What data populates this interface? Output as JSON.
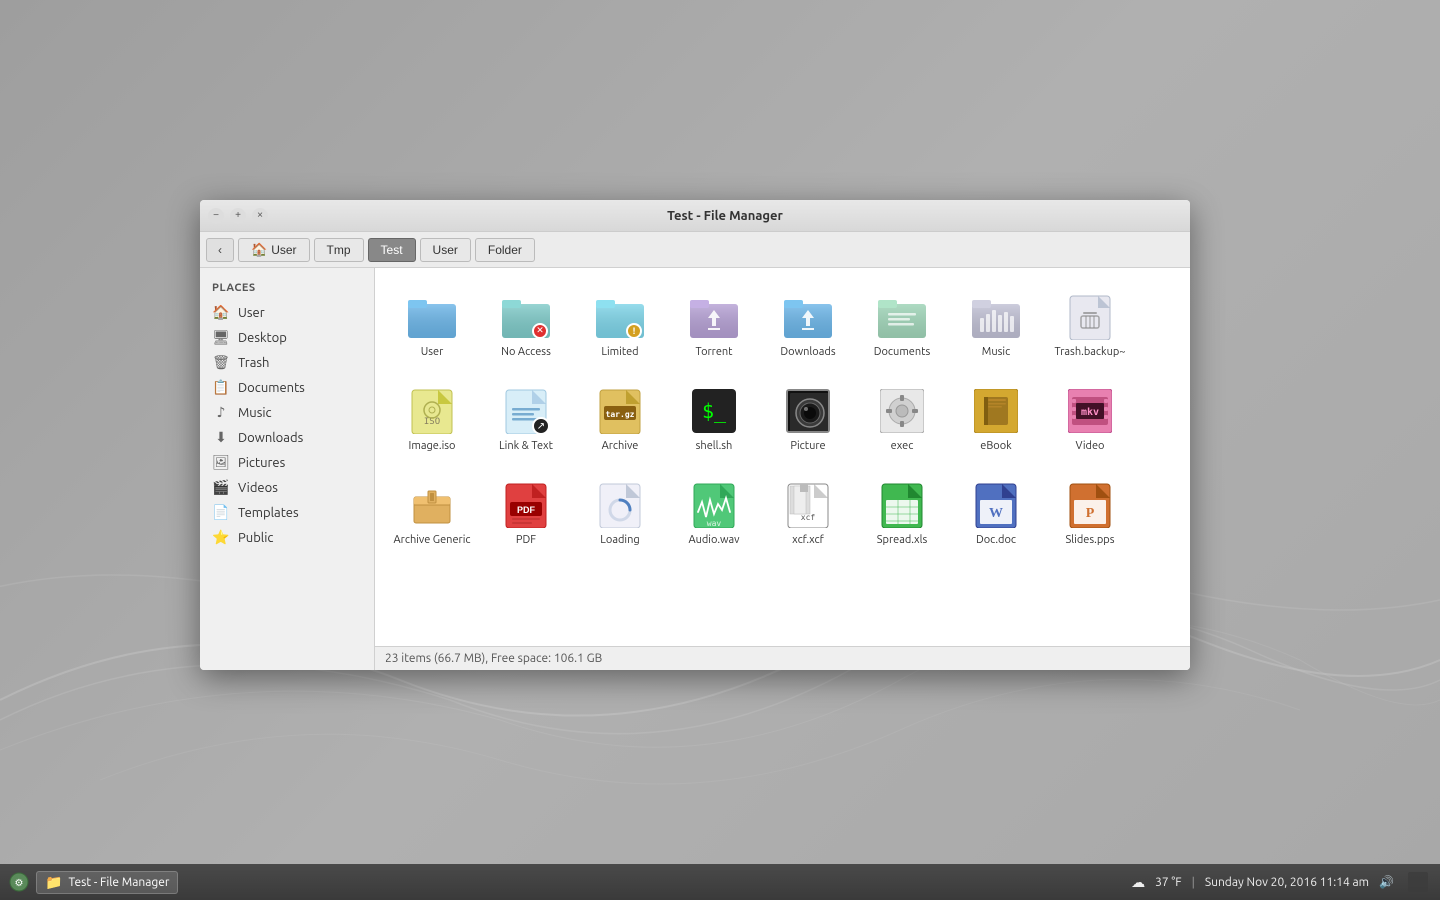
{
  "window": {
    "title": "Test - File Manager"
  },
  "titlebar": {
    "title": "Test - File Manager",
    "minimize_label": "−",
    "maximize_label": "+",
    "close_label": "×"
  },
  "toolbar": {
    "back_label": "‹",
    "breadcrumbs": [
      {
        "id": "user",
        "label": "User",
        "icon": "🏠",
        "active": false
      },
      {
        "id": "tmp",
        "label": "Tmp",
        "icon": "",
        "active": false
      },
      {
        "id": "test",
        "label": "Test",
        "icon": "",
        "active": true
      },
      {
        "id": "user2",
        "label": "User",
        "icon": "",
        "active": false
      },
      {
        "id": "folder",
        "label": "Folder",
        "icon": "",
        "active": false
      }
    ]
  },
  "sidebar": {
    "section_title": "PLACES",
    "items": [
      {
        "id": "user",
        "label": "User",
        "icon": "🏠"
      },
      {
        "id": "desktop",
        "label": "Desktop",
        "icon": "🖥"
      },
      {
        "id": "trash",
        "label": "Trash",
        "icon": "🗑"
      },
      {
        "id": "documents",
        "label": "Documents",
        "icon": "📋"
      },
      {
        "id": "music",
        "label": "Music",
        "icon": "♪"
      },
      {
        "id": "downloads",
        "label": "Downloads",
        "icon": "⬇"
      },
      {
        "id": "pictures",
        "label": "Pictures",
        "icon": "🖼"
      },
      {
        "id": "videos",
        "label": "Videos",
        "icon": "🎬"
      },
      {
        "id": "templates",
        "label": "Templates",
        "icon": "📄"
      },
      {
        "id": "public",
        "label": "Public",
        "icon": "⭐"
      }
    ]
  },
  "files": [
    {
      "id": "user-folder",
      "label": "User",
      "type": "folder-blue",
      "badge": ""
    },
    {
      "id": "no-access-folder",
      "label": "No Access",
      "type": "folder-teal",
      "badge": "no-access"
    },
    {
      "id": "limited-folder",
      "label": "Limited",
      "type": "folder-cyan",
      "badge": "limited"
    },
    {
      "id": "torrent-folder",
      "label": "Torrent",
      "type": "folder-purple",
      "badge": "torrent"
    },
    {
      "id": "downloads-folder",
      "label": "Downloads",
      "type": "folder-blue-download",
      "badge": ""
    },
    {
      "id": "documents-folder",
      "label": "Documents",
      "type": "folder-teal-doc",
      "badge": ""
    },
    {
      "id": "music-folder",
      "label": "Music",
      "type": "folder-gray",
      "badge": ""
    },
    {
      "id": "trash-backup",
      "label": "Trash.backup~",
      "type": "trash",
      "badge": ""
    },
    {
      "id": "image-iso",
      "label": "Image.iso",
      "type": "iso",
      "badge": ""
    },
    {
      "id": "link-text",
      "label": "Link & Text",
      "type": "linktext",
      "badge": ""
    },
    {
      "id": "archive",
      "label": "Archive",
      "type": "archive-tar",
      "badge": ""
    },
    {
      "id": "shell-sh",
      "label": "shell.sh",
      "type": "shell",
      "badge": ""
    },
    {
      "id": "picture",
      "label": "Picture",
      "type": "picture",
      "badge": ""
    },
    {
      "id": "exec",
      "label": "exec",
      "type": "exec",
      "badge": ""
    },
    {
      "id": "ebook",
      "label": "eBook",
      "type": "ebook",
      "badge": ""
    },
    {
      "id": "video",
      "label": "Video",
      "type": "video",
      "badge": ""
    },
    {
      "id": "archive-generic",
      "label": "Archive Generic",
      "type": "archive-generic",
      "badge": ""
    },
    {
      "id": "pdf",
      "label": "PDF",
      "type": "pdf",
      "badge": ""
    },
    {
      "id": "loading",
      "label": "Loading",
      "type": "loading",
      "badge": ""
    },
    {
      "id": "audio-wav",
      "label": "Audio.wav",
      "type": "audio",
      "badge": ""
    },
    {
      "id": "xcf",
      "label": "xcf.xcf",
      "type": "xcf",
      "badge": ""
    },
    {
      "id": "spreadsheet",
      "label": "Spread.xls",
      "type": "spreadsheet",
      "badge": ""
    },
    {
      "id": "doc",
      "label": "Doc.doc",
      "type": "doc",
      "badge": ""
    },
    {
      "id": "slides",
      "label": "Slides.pps",
      "type": "slides",
      "badge": ""
    }
  ],
  "statusbar": {
    "text": "23 items (66.7 MB), Free space: 106.1 GB"
  },
  "taskbar": {
    "app_label": "Test - File Manager",
    "weather": "37 °F",
    "datetime": "Sunday Nov 20, 2016  11:14 am",
    "volume_icon": "🔊"
  }
}
